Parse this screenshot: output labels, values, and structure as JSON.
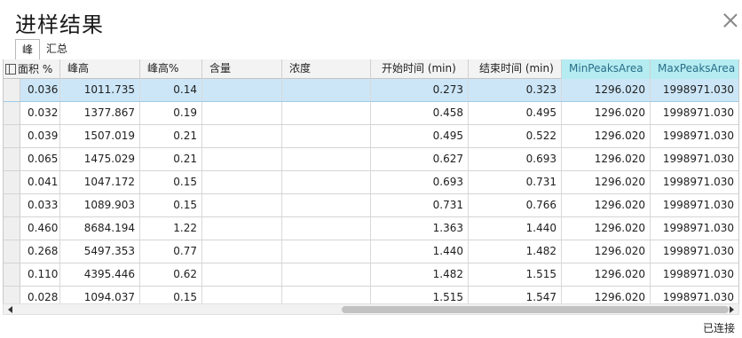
{
  "window": {
    "title": "进样结果"
  },
  "tabs": [
    {
      "label": "峰"
    },
    {
      "label": "汇总"
    }
  ],
  "columns": [
    {
      "label": "面积 %"
    },
    {
      "label": "峰高"
    },
    {
      "label": "峰高%"
    },
    {
      "label": "含量"
    },
    {
      "label": "浓度"
    },
    {
      "label": "开始时间 (min)"
    },
    {
      "label": "结束时间 (min)"
    },
    {
      "label": "MinPeaksArea"
    },
    {
      "label": "MaxPeaksArea"
    }
  ],
  "rows": [
    {
      "area_pct": "0.036",
      "height": "1011.735",
      "height_pct": "0.14",
      "content": "",
      "conc": "",
      "start": "0.273",
      "end": "0.323",
      "min_area": "1296.020",
      "max_area": "1998971.030"
    },
    {
      "area_pct": "0.032",
      "height": "1377.867",
      "height_pct": "0.19",
      "content": "",
      "conc": "",
      "start": "0.458",
      "end": "0.495",
      "min_area": "1296.020",
      "max_area": "1998971.030"
    },
    {
      "area_pct": "0.039",
      "height": "1507.019",
      "height_pct": "0.21",
      "content": "",
      "conc": "",
      "start": "0.495",
      "end": "0.522",
      "min_area": "1296.020",
      "max_area": "1998971.030"
    },
    {
      "area_pct": "0.065",
      "height": "1475.029",
      "height_pct": "0.21",
      "content": "",
      "conc": "",
      "start": "0.627",
      "end": "0.693",
      "min_area": "1296.020",
      "max_area": "1998971.030"
    },
    {
      "area_pct": "0.041",
      "height": "1047.172",
      "height_pct": "0.15",
      "content": "",
      "conc": "",
      "start": "0.693",
      "end": "0.731",
      "min_area": "1296.020",
      "max_area": "1998971.030"
    },
    {
      "area_pct": "0.033",
      "height": "1089.903",
      "height_pct": "0.15",
      "content": "",
      "conc": "",
      "start": "0.731",
      "end": "0.766",
      "min_area": "1296.020",
      "max_area": "1998971.030"
    },
    {
      "area_pct": "0.460",
      "height": "8684.194",
      "height_pct": "1.22",
      "content": "",
      "conc": "",
      "start": "1.363",
      "end": "1.440",
      "min_area": "1296.020",
      "max_area": "1998971.030"
    },
    {
      "area_pct": "0.268",
      "height": "5497.353",
      "height_pct": "0.77",
      "content": "",
      "conc": "",
      "start": "1.440",
      "end": "1.482",
      "min_area": "1296.020",
      "max_area": "1998971.030"
    },
    {
      "area_pct": "0.110",
      "height": "4395.446",
      "height_pct": "0.62",
      "content": "",
      "conc": "",
      "start": "1.482",
      "end": "1.515",
      "min_area": "1296.020",
      "max_area": "1998971.030"
    },
    {
      "area_pct": "0.028",
      "height": "1094.037",
      "height_pct": "0.15",
      "content": "",
      "conc": "",
      "start": "1.515",
      "end": "1.547",
      "min_area": "1296.020",
      "max_area": "1998971.030"
    }
  ],
  "status": {
    "text": "已连接"
  },
  "colors": {
    "selected_row": "#cce6f7",
    "highlight_header": "#b4ecf2",
    "highlight_header_text": "#2a6e88"
  },
  "icons": {
    "close": "close-icon",
    "column_chooser": "column-chooser-icon",
    "scroll_left": "scroll-left-icon",
    "scroll_right": "scroll-right-icon"
  }
}
